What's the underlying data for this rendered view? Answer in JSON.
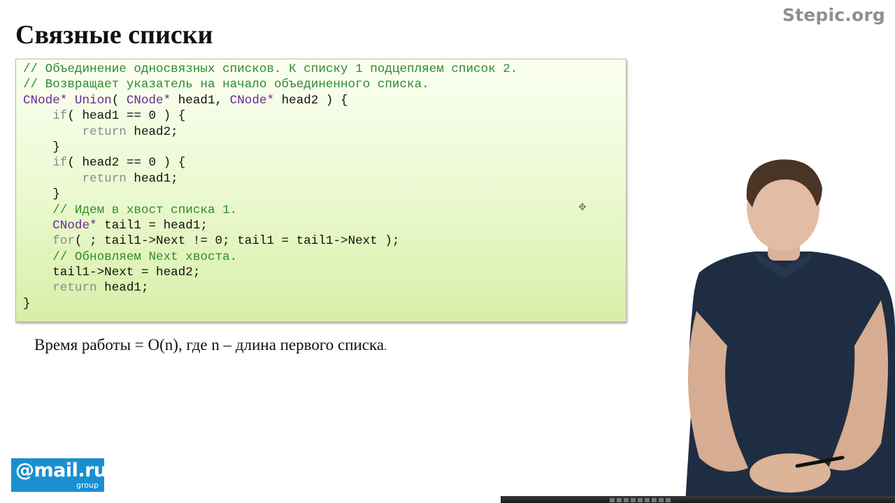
{
  "slide": {
    "title": "Связные списки",
    "watermark": "Stepic.org",
    "caption_main": "Время работы = O(n), где n – длина первого списка",
    "caption_end": ".",
    "cursor_glyph": "✥"
  },
  "code": {
    "lines": [
      [
        {
          "t": "// Объединение односвязных списков. К списку 1 подцепляем список 2.",
          "c": "c"
        }
      ],
      [
        {
          "t": "// Возвращает указатель на начало объединенного списка.",
          "c": "c"
        }
      ],
      [
        {
          "t": "CNode* Union",
          "c": "t"
        },
        {
          "t": "( ",
          "c": ""
        },
        {
          "t": "CNode*",
          "c": "t"
        },
        {
          "t": " head1, ",
          "c": ""
        },
        {
          "t": "CNode*",
          "c": "t"
        },
        {
          "t": " head2 ) {",
          "c": ""
        }
      ],
      [
        {
          "t": "    ",
          "c": ""
        },
        {
          "t": "if",
          "c": "k"
        },
        {
          "t": "( head1 == 0 ) {",
          "c": ""
        }
      ],
      [
        {
          "t": "        ",
          "c": ""
        },
        {
          "t": "return",
          "c": "k"
        },
        {
          "t": " head2;",
          "c": ""
        }
      ],
      [
        {
          "t": "    }",
          "c": ""
        }
      ],
      [
        {
          "t": "    ",
          "c": ""
        },
        {
          "t": "if",
          "c": "k"
        },
        {
          "t": "( head2 == 0 ) {",
          "c": ""
        }
      ],
      [
        {
          "t": "        ",
          "c": ""
        },
        {
          "t": "return",
          "c": "k"
        },
        {
          "t": " head1;",
          "c": ""
        }
      ],
      [
        {
          "t": "    }",
          "c": ""
        }
      ],
      [
        {
          "t": "    ",
          "c": ""
        },
        {
          "t": "// Идем в хвост списка 1.",
          "c": "c"
        }
      ],
      [
        {
          "t": "    ",
          "c": ""
        },
        {
          "t": "CNode*",
          "c": "t"
        },
        {
          "t": " tail1 = head1;",
          "c": ""
        }
      ],
      [
        {
          "t": "    ",
          "c": ""
        },
        {
          "t": "for",
          "c": "k"
        },
        {
          "t": "( ; tail1->Next != 0; tail1 = tail1->Next );",
          "c": ""
        }
      ],
      [
        {
          "t": "    ",
          "c": ""
        },
        {
          "t": "// Обновляем Next хвоста.",
          "c": "c"
        }
      ],
      [
        {
          "t": "    tail1->Next = head2;",
          "c": ""
        }
      ],
      [
        {
          "t": "    ",
          "c": ""
        },
        {
          "t": "return",
          "c": "k"
        },
        {
          "t": " head1;",
          "c": ""
        }
      ],
      [
        {
          "t": "}",
          "c": ""
        }
      ]
    ]
  },
  "logo": {
    "main": "@mail.ru",
    "sub": "group",
    "color": "#1a8fd0"
  },
  "colors": {
    "comment": "#2e8b2e",
    "type": "#6a2a96",
    "keyword": "#8a8a8a"
  }
}
